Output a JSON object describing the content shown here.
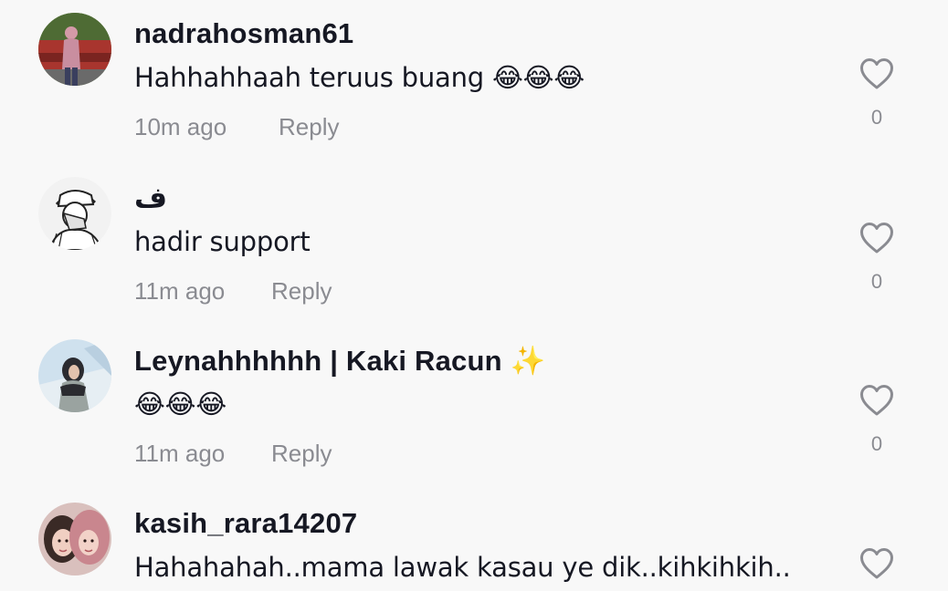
{
  "comments": [
    {
      "username": "nadrahosman61",
      "text": "Hahhahhaah teruus buang 😂😂😂",
      "time": "10m ago",
      "reply_label": "Reply",
      "likes": "0",
      "avatar_icon": "avatar-photo-woman-car"
    },
    {
      "username": "ف",
      "text": "hadir support",
      "time": "11m ago",
      "reply_label": "Reply",
      "likes": "0",
      "avatar_icon": "avatar-sketch-man"
    },
    {
      "username": "Leynahhhhhh | Kaki Racun ✨",
      "text": "😂😂😂",
      "time": "11m ago",
      "reply_label": "Reply",
      "likes": "0",
      "avatar_icon": "avatar-photo-hijab-woman"
    },
    {
      "username": "kasih_rara14207",
      "text": "Hahahahah..mama lawak kasau ye dik..kihkihkih..",
      "time": "",
      "reply_label": "",
      "likes": "",
      "avatar_icon": "avatar-photo-two-women"
    }
  ],
  "colors": {
    "background": "#f8f8f8",
    "primary_text": "#161823",
    "secondary_text": "#8a8b91",
    "heart_outline": "#8a8b91"
  }
}
